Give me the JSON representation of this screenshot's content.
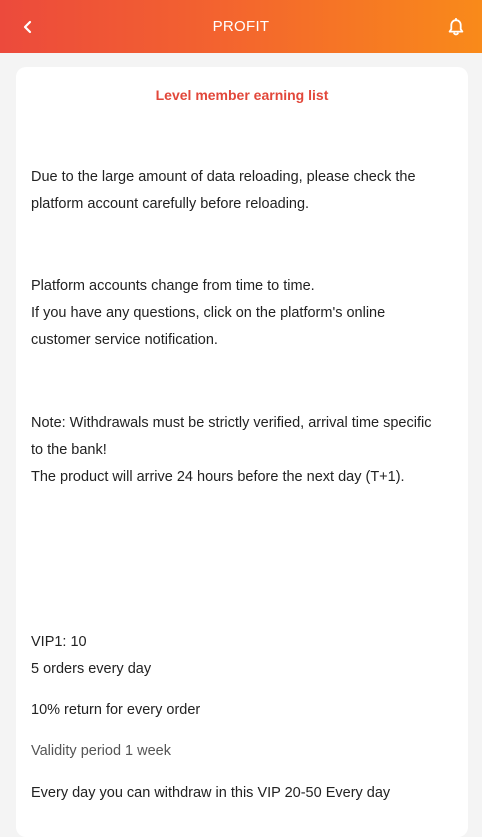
{
  "header": {
    "title": "PROFIT",
    "back_icon": "chevron-left-icon",
    "bell_icon": "bell-icon",
    "gradient_start": "#ec4a3c",
    "gradient_end": "#f98a1a"
  },
  "card": {
    "title": "Level member earning list",
    "paragraph1": [
      "Due to the large amount of data reloading, please check the",
      "platform account carefully before reloading."
    ],
    "paragraph2": [
      "Platform accounts change from time to time.",
      "If you have any questions, click on the platform's online",
      "customer service notification."
    ],
    "paragraph3": [
      "Note: Withdrawals must be strictly verified, arrival time specific",
      "to the bank!",
      "The product will arrive 24 hours before the next day (T+1)."
    ],
    "vip": {
      "level": "VIP1: 10",
      "orders": "5 orders every day",
      "return": "10% return for every order",
      "validity": "Validity period 1 week",
      "withdraw": "Every day you can withdraw in this VIP 20-50 Every day"
    }
  }
}
